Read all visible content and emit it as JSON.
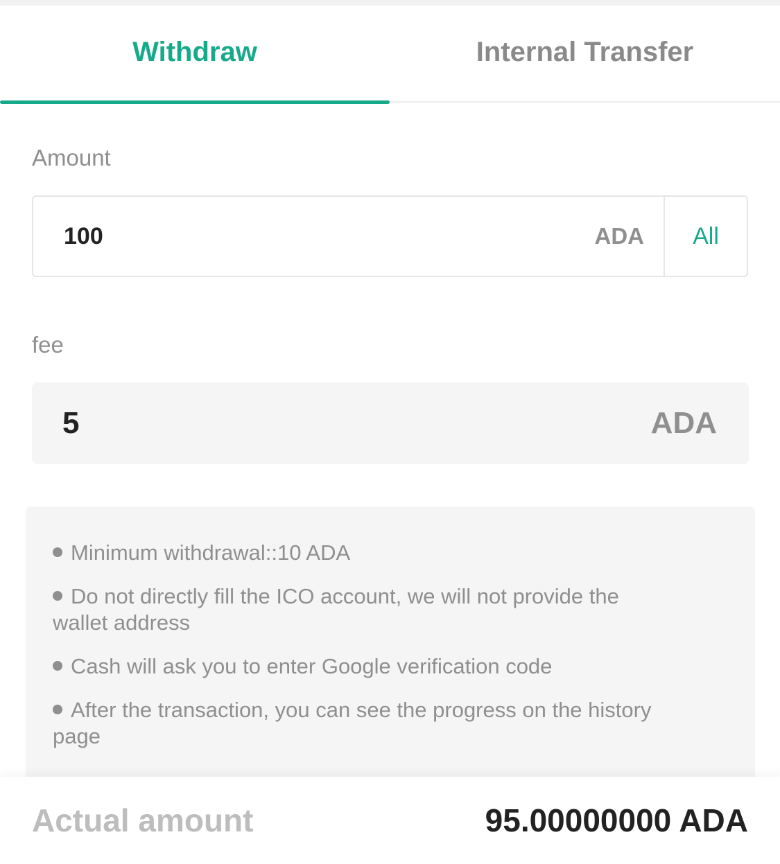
{
  "tabs": [
    {
      "label": "Withdraw",
      "active": true
    },
    {
      "label": "Internal Transfer",
      "active": false
    }
  ],
  "amount": {
    "label": "Amount",
    "value": "100",
    "unit": "ADA",
    "all_label": "All"
  },
  "fee": {
    "label": "fee",
    "value": "5",
    "unit": "ADA"
  },
  "notes": [
    "Minimum withdrawal::10 ADA",
    "Do not directly fill the ICO account, we will not provide the wallet address",
    "Cash will ask you to enter Google verification code",
    "After the transaction, you can see the progress on the history page"
  ],
  "summary": {
    "label": "Actual amount",
    "value": "95.00000000 ADA"
  },
  "colors": {
    "accent": "#16a98a",
    "muted_text": "#8f8f8f",
    "panel_bg": "#f5f5f5"
  }
}
